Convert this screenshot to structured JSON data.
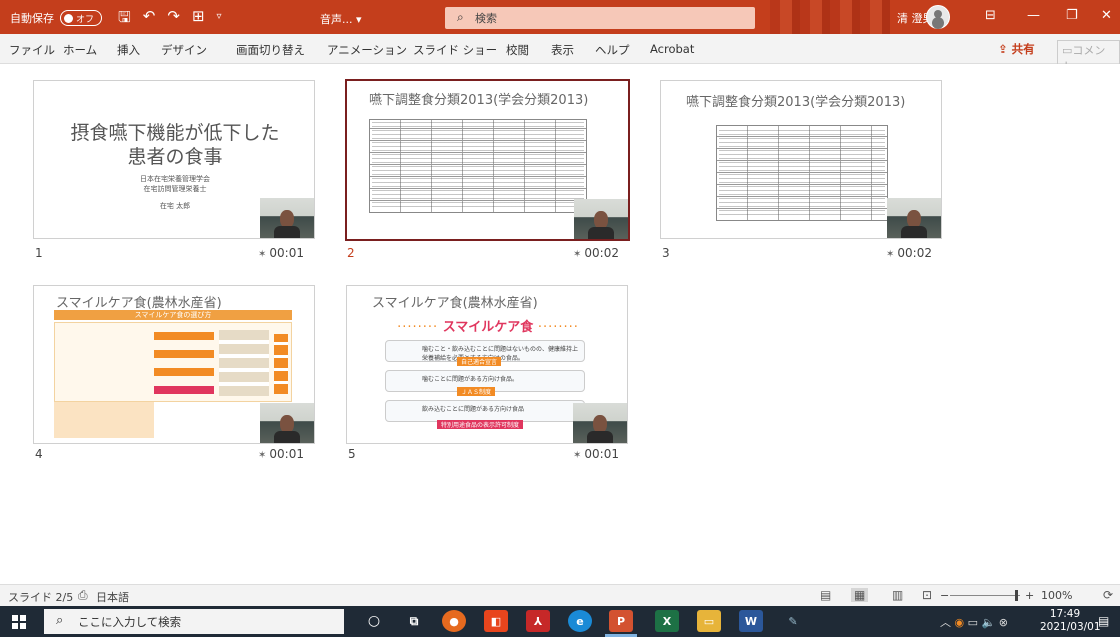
{
  "titlebar": {
    "autosave_label": "自動保存",
    "autosave_state": "オフ",
    "filename": "音声...",
    "search_placeholder": "検索",
    "user_name": "清 澄男"
  },
  "menu": {
    "items": [
      "ファイル",
      "ホーム",
      "挿入",
      "デザイン",
      "画面切り替え",
      "アニメーション",
      "スライド ショー",
      "校閲",
      "表示",
      "ヘルプ",
      "Acrobat"
    ],
    "share": "共有",
    "comment": "コメント"
  },
  "slides": [
    {
      "number": "1",
      "time": "00:01",
      "title": "摂食嚥下機能が低下した患者の食事",
      "title_line1": "摂食嚥下機能が低下した",
      "title_line2": "患者の食事",
      "subtitle_line1": "日本在宅栄養管理学会",
      "subtitle_line2": "在宅訪問管理栄養士",
      "author": "在宅 太郎"
    },
    {
      "number": "2",
      "time": "00:02",
      "title": "嚥下調整食分類2013(学会分類2013)",
      "selected": true
    },
    {
      "number": "3",
      "time": "00:02",
      "title": "嚥下調整食分類2013(学会分類2013)"
    },
    {
      "number": "4",
      "time": "00:01",
      "title": "スマイルケア食(農林水産省)",
      "banner": "スマイルケア食の選び方"
    },
    {
      "number": "5",
      "time": "00:01",
      "title": "スマイルケア食(農林水産省)",
      "logo": "スマイルケア食",
      "row1": "噛むこと・飲み込むことに問題はないものの、健康維持上栄養補給を必要とする方向けの食品。",
      "row1_tag": "自己適合宣言",
      "row2": "噛むことに問題がある方向け食品。",
      "row2_tag": "ＪＡＳ制度",
      "row3": "飲み込むことに問題がある方向け食品",
      "row3_tag": "特別用途食品の表示許可制度"
    }
  ],
  "status": {
    "slide_indicator": "スライド 2/5",
    "language": "日本語",
    "zoom": "100%",
    "zoom_minus": "−",
    "zoom_plus": "+"
  },
  "taskbar": {
    "search_placeholder": "ここに入力して検索",
    "time": "17:49",
    "date": "2021/03/01"
  },
  "colors": {
    "accent": "#c43e1c",
    "taskbar": "#1f2a36",
    "selected_border": "#7a1f1f"
  }
}
